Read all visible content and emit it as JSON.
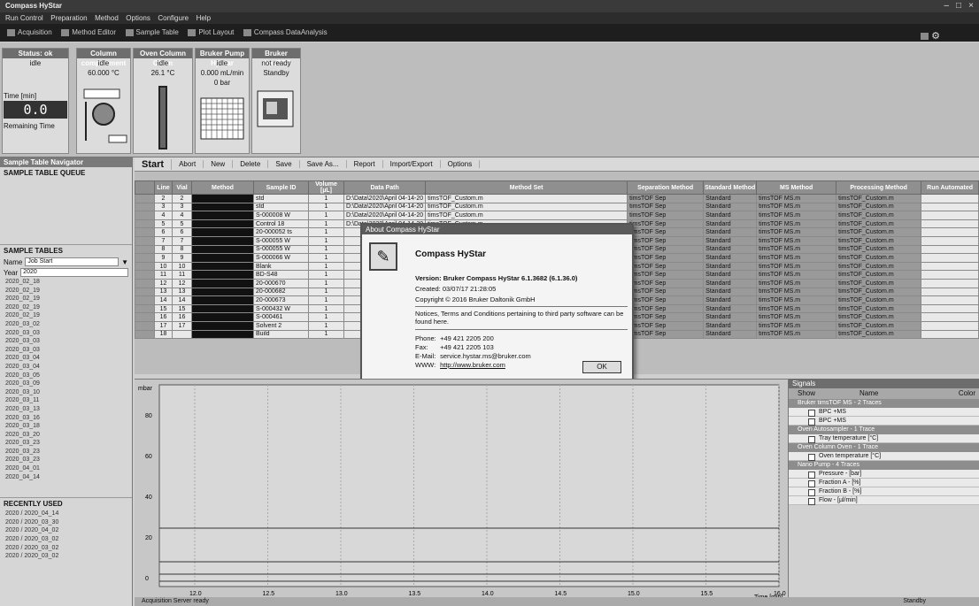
{
  "window": {
    "title": "Compass HyStar",
    "menu": [
      "Run Control",
      "Preparation",
      "Method",
      "Options",
      "Configure",
      "Help"
    ],
    "ribbon": [
      "Acquisition",
      "Method Editor",
      "Sample Table",
      "Plot Layout",
      "Compass DataAnalysis"
    ]
  },
  "instruments": [
    {
      "name": "Status: ok",
      "lines": [
        "idle"
      ]
    },
    {
      "name": "Column compartment",
      "lines": [
        "idle",
        "60.000 °C"
      ]
    },
    {
      "name": "Oven Column Chem",
      "lines": [
        "idle",
        "26.1 °C"
      ]
    },
    {
      "name": "Bruker Pump HyStar",
      "lines": [
        "idle",
        "0.000 mL/min",
        "0 bar"
      ]
    },
    {
      "name": "Bruker timsTOF",
      "lines": [
        "not ready",
        "Standby"
      ]
    }
  ],
  "runtime": {
    "label": "Time [min]",
    "value": "0.0",
    "remaining_label": "Remaining Time"
  },
  "leftpanel": {
    "title": "Sample Table Navigator",
    "queue_title": "SAMPLE TABLE QUEUE",
    "tables_title": "SAMPLE TABLES",
    "name_label": "Name",
    "name_value": "Job Start",
    "year_label": "Year",
    "year_value": "2020",
    "tables": [
      "2020_02_18",
      "2020_02_19",
      "2020_02_19",
      "2020_02_19",
      "2020_02_19",
      "2020_03_02",
      "2020_03_03",
      "2020_03_03",
      "2020_03_03",
      "2020_03_04",
      "2020_03_04",
      "2020_03_05",
      "2020_03_09",
      "2020_03_10",
      "2020_03_11",
      "2020_03_13",
      "2020_03_16",
      "2020_03_18",
      "2020_03_20",
      "2020_03_23",
      "2020_03_23",
      "2020_03_23",
      "2020_04_01",
      "2020_04_14"
    ],
    "recent_title": "RECENTLY USED",
    "recent": [
      "2020 / 2020_04_14",
      "2020 / 2020_03_30",
      "2020 / 2020_04_02",
      "2020 / 2020_03_02",
      "2020 / 2020_03_02",
      "2020 / 2020_03_02"
    ]
  },
  "toolbar": {
    "start": "Start",
    "abort": "Abort",
    "new": "New",
    "delete": "Delete",
    "save": "Save",
    "saveas": "Save As...",
    "report": "Report",
    "importexport": "Import/Export",
    "options": "Options"
  },
  "sequence": {
    "columns": [
      "",
      "Line",
      "Vial",
      "Method",
      "Sample ID",
      "Volume [µL]",
      "Data Path",
      "Method Set",
      "Separation Method",
      "Standard Method",
      "MS Method",
      "Processing Method",
      "Run Automated"
    ],
    "rows": [
      {
        "line": "2",
        "vial": "2",
        "sample": "std",
        "vol": "1",
        "path": "D:\\Data\\2020\\April 04-14-20",
        "method": "timsTOF_Custom.m"
      },
      {
        "line": "3",
        "vial": "3",
        "sample": "std",
        "vol": "1",
        "path": "D:\\Data\\2020\\April 04-14-20",
        "method": "timsTOF_Custom.m"
      },
      {
        "line": "4",
        "vial": "4",
        "sample": "S-000008 W",
        "vol": "1",
        "path": "D:\\Data\\2020\\April 04-14-20",
        "method": "timsTOF_Custom.m"
      },
      {
        "line": "5",
        "vial": "5",
        "sample": "Control 18",
        "vol": "1",
        "path": "D:\\Data\\2020\\April 04-14-20",
        "method": "timsTOF_Custom.m"
      },
      {
        "line": "6",
        "vial": "6",
        "sample": "20-000052 ts",
        "vol": "1",
        "path": "",
        "method": ""
      },
      {
        "line": "7",
        "vial": "7",
        "sample": "S-000055 W",
        "vol": "1",
        "path": "",
        "method": ""
      },
      {
        "line": "8",
        "vial": "8",
        "sample": "S-000055 W",
        "vol": "1",
        "path": "",
        "method": ""
      },
      {
        "line": "9",
        "vial": "9",
        "sample": "S-000066 W",
        "vol": "1",
        "path": "",
        "method": ""
      },
      {
        "line": "10",
        "vial": "10",
        "sample": "Blank",
        "vol": "1",
        "path": "",
        "method": ""
      },
      {
        "line": "11",
        "vial": "11",
        "sample": "BD-S48",
        "vol": "1",
        "path": "",
        "method": ""
      },
      {
        "line": "12",
        "vial": "12",
        "sample": "20-000670",
        "vol": "1",
        "path": "",
        "method": ""
      },
      {
        "line": "13",
        "vial": "13",
        "sample": "20-000682",
        "vol": "1",
        "path": "",
        "method": ""
      },
      {
        "line": "14",
        "vial": "14",
        "sample": "20-000673",
        "vol": "1",
        "path": "",
        "method": ""
      },
      {
        "line": "15",
        "vial": "15",
        "sample": "S-000432 W",
        "vol": "1",
        "path": "",
        "method": ""
      },
      {
        "line": "16",
        "vial": "16",
        "sample": "S-000461",
        "vol": "1",
        "path": "",
        "method": ""
      },
      {
        "line": "17",
        "vial": "17",
        "sample": "Solvent 2",
        "vol": "1",
        "path": "",
        "method": ""
      },
      {
        "line": "18",
        "vial": "",
        "sample": "Build",
        "vol": "1",
        "path": "",
        "method": ""
      }
    ],
    "sep_value": "timsTOF Sep",
    "std_value": "Standard",
    "ms_value": "timsTOF MS.m",
    "proc_value": "timsTOF_Custom.m"
  },
  "about": {
    "title": "About Compass HyStar",
    "app": "Compass HyStar",
    "version_label": "Version:",
    "version": "Bruker Compass HyStar 6.1.3682 (6.1.36.0)",
    "created": "Created: 03/07/17 21:28:05",
    "copyright": "Copyright © 2016 Bruker Daltonik GmbH",
    "notice": "Notices, Terms and Conditions pertaining to third party software can be found here.",
    "phone_label": "Phone:",
    "phone": "+49 421 2205 200",
    "fax_label": "Fax:",
    "fax": "+49 421 2205 103",
    "email_label": "E-Mail:",
    "email": "service.hystar.ms@bruker.com",
    "web_label": "WWW:",
    "web": "http://www.bruker.com",
    "ok": "OK"
  },
  "plot": {
    "ylabel": "mbar",
    "yticks": [
      "80",
      "60",
      "40",
      "20",
      "0"
    ],
    "xticks": [
      "12.0",
      "12.5",
      "13.0",
      "13.5",
      "14.0",
      "14.5",
      "15.0",
      "15.5",
      "16.0"
    ],
    "xlabel": "Time [min]"
  },
  "signals": {
    "title": "Signals",
    "col_show": "Show",
    "col_name": "Name",
    "col_color": "Color",
    "groups": [
      {
        "name": "Bruker timsTOF MS - 2 Traces",
        "items": [
          "BPC +MS",
          "BPC +MS"
        ]
      },
      {
        "name": "Oven Autosampler - 1 Trace",
        "items": [
          "Tray temperature [°C]"
        ]
      },
      {
        "name": "Oven Column Oven - 1 Trace",
        "items": [
          "Oven temperature [°C]"
        ]
      },
      {
        "name": "Nano Pump - 4 Traces",
        "items": [
          "Pressure - [bar]",
          "Fraction A - [%]",
          "Fraction B - [%]",
          "Flow - [µl/min]"
        ]
      }
    ]
  },
  "status": {
    "text": "Acquisition Server ready",
    "right": "Standby"
  }
}
